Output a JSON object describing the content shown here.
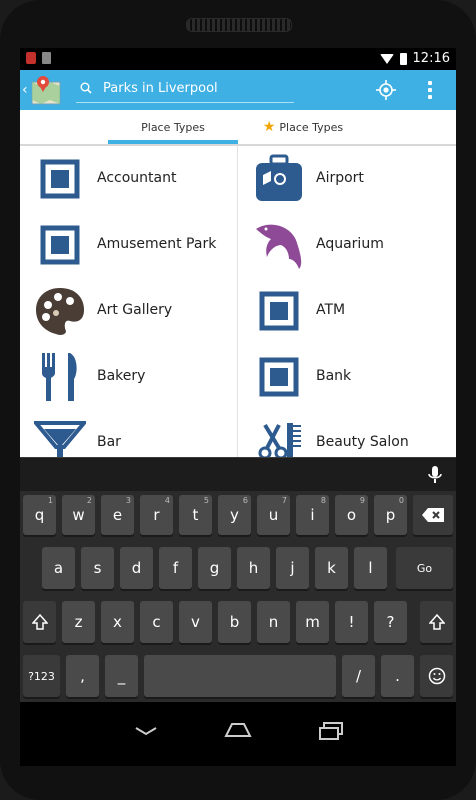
{
  "status": {
    "time": "12:16"
  },
  "search": {
    "query": "Parks in Liverpool"
  },
  "tabs": [
    {
      "label": "Place Types",
      "selected": true
    },
    {
      "label": "Place Types",
      "icon": "star-icon",
      "selected": false
    }
  ],
  "places": [
    {
      "label": "Accountant",
      "icon": "square-frame-icon"
    },
    {
      "label": "Airport",
      "icon": "suitcase-icon"
    },
    {
      "label": "Amusement Park",
      "icon": "square-frame-icon"
    },
    {
      "label": "Aquarium",
      "icon": "dolphin-icon"
    },
    {
      "label": "Art Gallery",
      "icon": "palette-icon"
    },
    {
      "label": "ATM",
      "icon": "square-frame-icon"
    },
    {
      "label": "Bakery",
      "icon": "fork-knife-icon"
    },
    {
      "label": "Bank",
      "icon": "square-frame-icon"
    },
    {
      "label": "Bar",
      "icon": "cocktail-icon"
    },
    {
      "label": "Beauty Salon",
      "icon": "scissors-comb-icon"
    }
  ],
  "keyboard": {
    "row1": [
      {
        "key": "q",
        "sub": "1"
      },
      {
        "key": "w",
        "sub": "2"
      },
      {
        "key": "e",
        "sub": "3"
      },
      {
        "key": "r",
        "sub": "4"
      },
      {
        "key": "t",
        "sub": "5"
      },
      {
        "key": "y",
        "sub": "6"
      },
      {
        "key": "u",
        "sub": "7"
      },
      {
        "key": "i",
        "sub": "8"
      },
      {
        "key": "o",
        "sub": "9"
      },
      {
        "key": "p",
        "sub": "0"
      }
    ],
    "row2": [
      "a",
      "s",
      "d",
      "f",
      "g",
      "h",
      "j",
      "k",
      "l"
    ],
    "go": "Go",
    "row3": [
      "z",
      "x",
      "c",
      "v",
      "b",
      "n",
      "m",
      "!",
      "?"
    ],
    "symbols": "?123",
    "comma": ",",
    "underscore": "_",
    "slash": "/",
    "period": "."
  },
  "colors": {
    "accent": "#3fb0e3",
    "icon_blue": "#2d5b8f",
    "icon_purple": "#8e4a96"
  }
}
